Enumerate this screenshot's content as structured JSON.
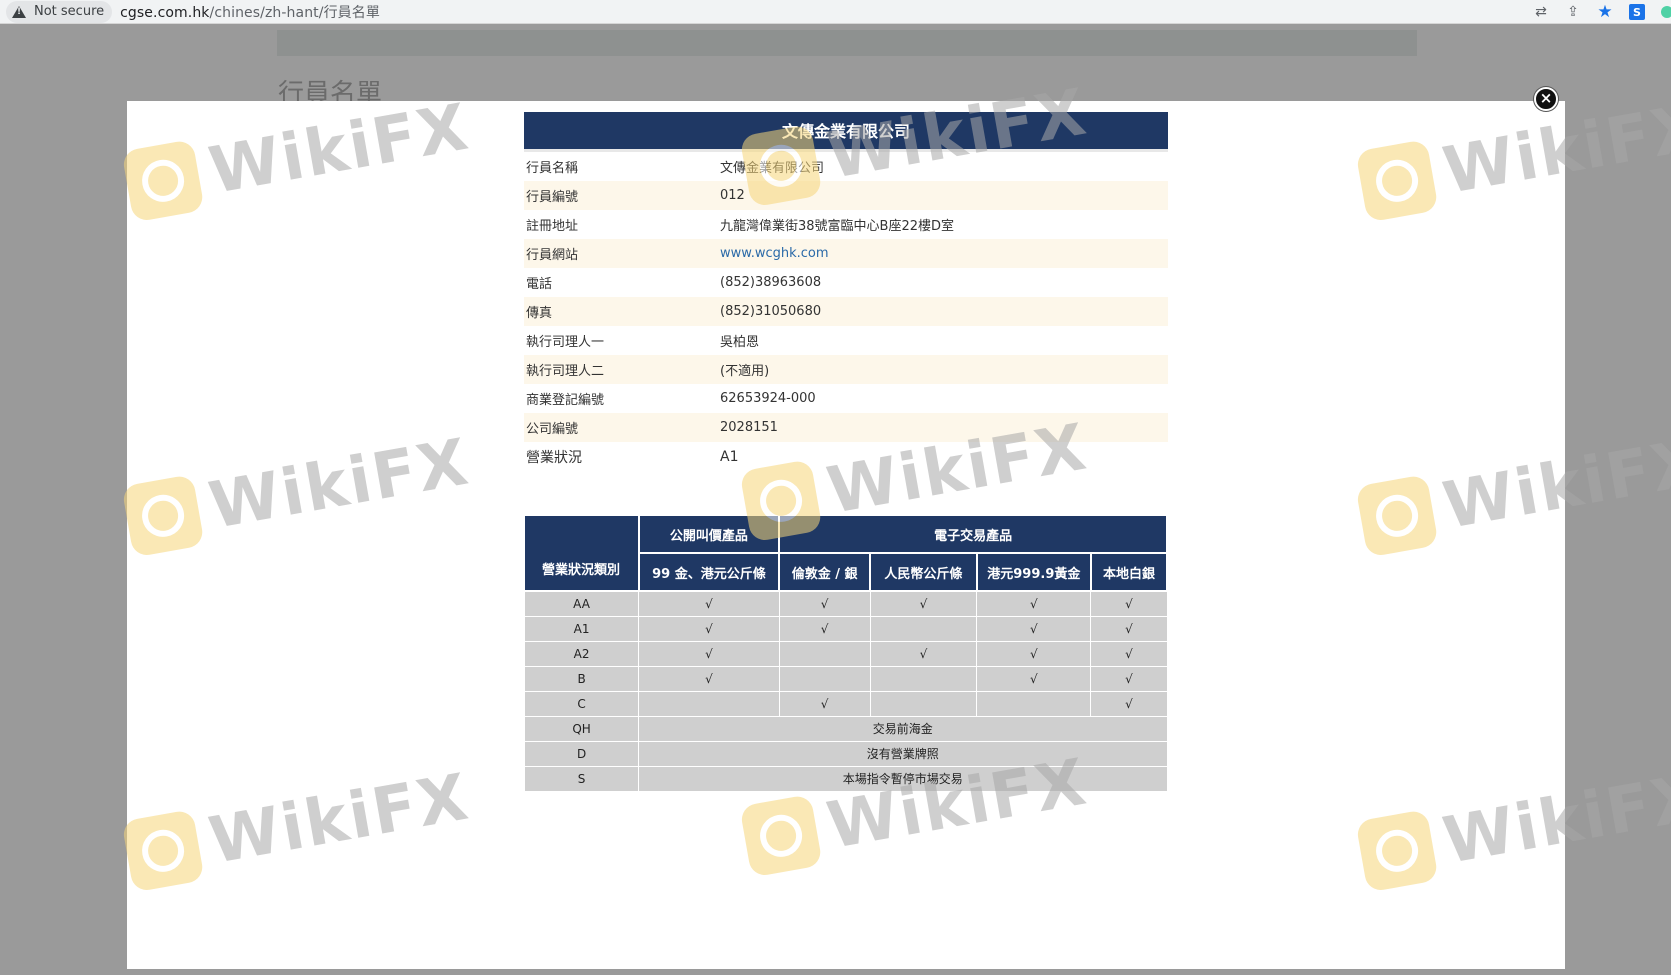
{
  "browser": {
    "security_label": "Not secure",
    "url_host": "cgse.com.hk",
    "url_path": "/chines/zh-hant/行員名單",
    "icons": [
      "translate-icon",
      "share-icon",
      "star-icon",
      "extension-icon",
      "profile-icon"
    ]
  },
  "background_page": {
    "title": "行員名單"
  },
  "modal": {
    "close_label": "×",
    "company_name": "文傳金業有限公司",
    "info": [
      {
        "key": "行員名稱",
        "value": "文傳金業有限公司"
      },
      {
        "key": "行員編號",
        "value": "012"
      },
      {
        "key": "註冊地址",
        "value": "九龍灣偉業街38號富臨中心B座22樓D室"
      },
      {
        "key": "行員網站",
        "value": "www.wcghk.com"
      },
      {
        "key": "電話",
        "value": "(852)38963608"
      },
      {
        "key": "傳真",
        "value": "(852)31050680"
      },
      {
        "key": "執行司理人一",
        "value": "吳柏恩"
      },
      {
        "key": "執行司理人二",
        "value": "(不適用)"
      },
      {
        "key": "商業登記編號",
        "value": "62653924-000"
      },
      {
        "key": "公司編號",
        "value": "2028151"
      },
      {
        "key": "營業狀況",
        "value": "A1"
      }
    ],
    "status_table": {
      "category_header": "營業狀況類別",
      "group_public": "公開叫價產品",
      "group_electronic": "電子交易產品",
      "columns": [
        "99 金、港元公斤條",
        "倫敦金 / 銀",
        "人民幣公斤條",
        "港元999.9黃金",
        "本地白銀"
      ],
      "check_mark": "√",
      "rows": [
        {
          "code": "AA",
          "cells": [
            "√",
            "√",
            "√",
            "√",
            "√"
          ]
        },
        {
          "code": "A1",
          "cells": [
            "√",
            "√",
            "",
            "√",
            "√"
          ]
        },
        {
          "code": "A2",
          "cells": [
            "√",
            "",
            "√",
            "√",
            "√"
          ]
        },
        {
          "code": "B",
          "cells": [
            "√",
            "",
            "",
            "√",
            "√"
          ]
        },
        {
          "code": "C",
          "cells": [
            "",
            "√",
            "",
            "",
            "√"
          ]
        }
      ],
      "span_rows": [
        {
          "code": "QH",
          "text": "交易前海金"
        },
        {
          "code": "D",
          "text": "沒有營業牌照"
        },
        {
          "code": "S",
          "text": "本場指令暫停市場交易"
        }
      ]
    }
  },
  "watermark": {
    "text": "WikiFX"
  },
  "colors": {
    "header_navy": "#1f3864",
    "row_alt": "#fdf7ea",
    "status_cell": "#cfcfcf",
    "link": "#2b6aa8"
  }
}
